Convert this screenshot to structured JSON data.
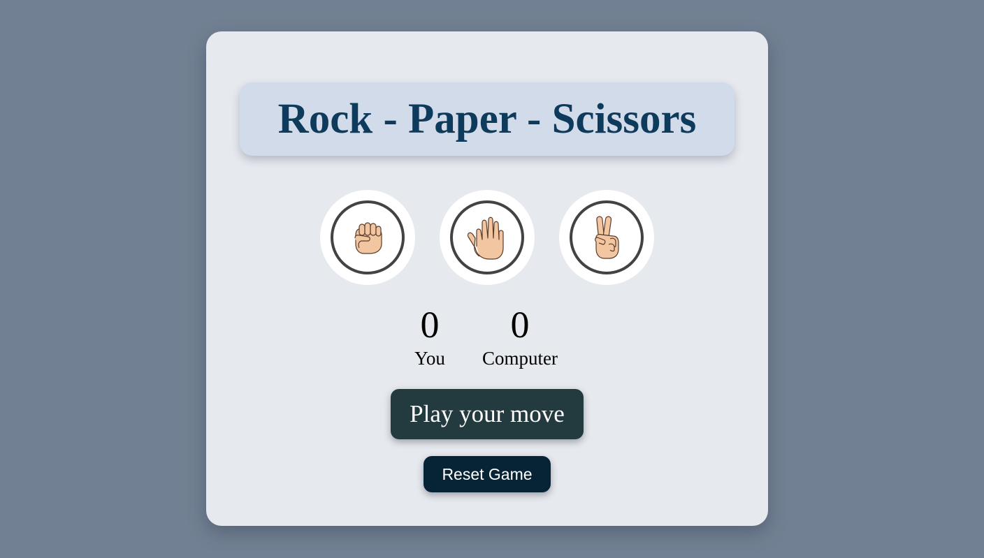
{
  "header": {
    "title": "Rock - Paper - Scissors"
  },
  "choices": [
    {
      "name": "rock",
      "icon": "fist-hand-icon"
    },
    {
      "name": "paper",
      "icon": "open-hand-icon"
    },
    {
      "name": "scissors",
      "icon": "victory-hand-icon"
    }
  ],
  "scoreboard": {
    "user_score": "0",
    "user_label": "You",
    "computer_score": "0",
    "computer_label": "Computer"
  },
  "message": {
    "text": "Play your move"
  },
  "controls": {
    "reset_label": "Reset Game"
  },
  "colors": {
    "page_background": "#728093",
    "card_background": "#e6e9ee",
    "title_background": "#d1dbea",
    "title_text": "#0e3a5b",
    "message_background": "#233b3e",
    "reset_background": "#072436",
    "skin": "#f3c6a2"
  }
}
